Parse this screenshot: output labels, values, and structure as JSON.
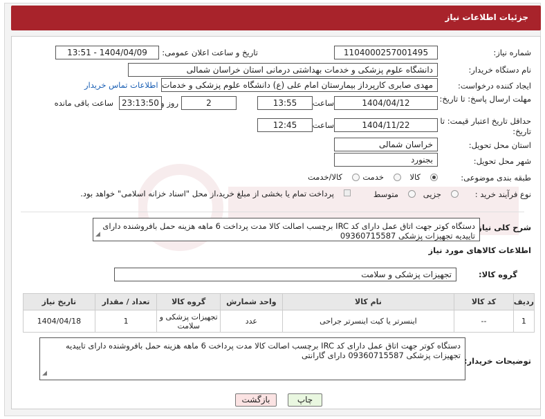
{
  "header": {
    "title": "جزئیات اطلاعات نیاز"
  },
  "fields": {
    "need_number_label": "شماره نیاز:",
    "need_number": "1104000257001495",
    "announce_label": "تاریخ و ساعت اعلان عمومی:",
    "announce_value": "1404/04/09 - 13:51",
    "buyer_org_label": "نام دستگاه خریدار:",
    "buyer_org": "دانشگاه علوم پزشکی و خدمات بهداشتی درمانی استان خراسان شمالی",
    "requester_label": "ایجاد کننده درخواست:",
    "requester": "مهدی صابری کارپرداز بیمارستان امام علی (ع) دانشگاه علوم پزشکی و خدمات ب",
    "contact_link": "اطلاعات تماس خریدار",
    "deadline_label": "مهلت ارسال پاسخ: تا تاریخ:",
    "deadline_date": "1404/04/12",
    "time_label": "ساعت",
    "deadline_time": "13:55",
    "days_value": "2",
    "days_label": "روز و",
    "remaining_time": "23:13:50",
    "remaining_label": "ساعت باقی مانده",
    "price_validity_label": "حداقل تاریخ اعتبار قیمت: تا تاریخ:",
    "price_date": "1404/11/22",
    "price_time": "12:45",
    "province_label": "استان محل تحویل:",
    "province": "خراسان شمالی",
    "city_label": "شهر محل تحویل:",
    "city": "بجنورد",
    "category_label": "طبقه بندی موضوعی:",
    "category_options": [
      "کالا",
      "خدمت",
      "کالا/خدمت"
    ],
    "process_label": "نوع فرآیند خرید :",
    "process_options": [
      "جزیی",
      "متوسط"
    ],
    "payment_note": "پرداخت تمام یا بخشی از مبلغ خرید،از محل \"اسناد خزانه اسلامی\" خواهد بود.",
    "description_label": "شرح کلی نیاز:",
    "description": "دستگاه کوتر جهت اتاق عمل دارای کد IRC برچسب اصالت کالا مدت پرداخت 6 ماهه هزینه حمل بافروشنده دارای تاییدیه تجهیزات پزشکی 09360715587",
    "goods_info_title": "اطلاعات کالاهای مورد نیاز",
    "goods_group_label": "گروه کالا:",
    "goods_group": "تجهیزات پزشکی و سلامت"
  },
  "table": {
    "headers": [
      "ردیف",
      "کد کالا",
      "نام کالا",
      "واحد شمارش",
      "گروه کالا",
      "تعداد / مقدار",
      "تاریخ نیاز"
    ],
    "rows": [
      [
        "1",
        "--",
        "اینسرتر یا کیت اینسرتر جراحی",
        "عدد",
        "تجهیزات پزشکی و سلامت",
        "1",
        "1404/04/18"
      ]
    ]
  },
  "buyer_notes_label": "توضیحات خریدار:",
  "buyer_notes": "دستگاه کوتر جهت اتاق عمل دارای کد IRC برچسب اصالت کالا مدت پرداخت 6 ماهه هزینه حمل بافروشنده دارای تاییدیه تجهیزات پزشکی 09360715587 دارای گارانتی",
  "buttons": {
    "print": "چاپ",
    "back": "بازگشت"
  },
  "colors": {
    "header_bg": "#a8232b",
    "print_bg": "#e9f7e0",
    "back_bg": "#fbe3e3"
  }
}
